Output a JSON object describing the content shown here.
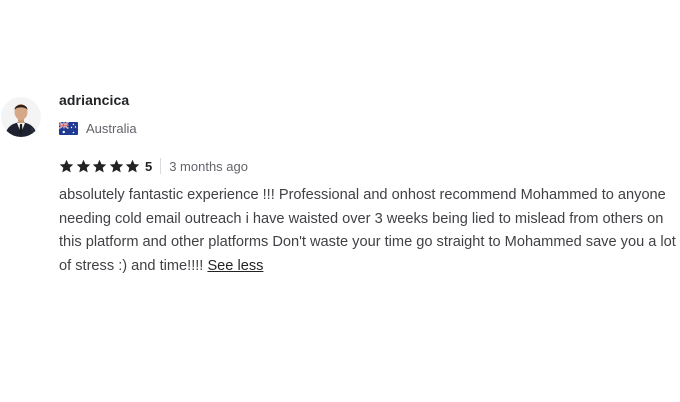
{
  "review": {
    "username": "adriancica",
    "avatar_icon": "user-avatar-photo",
    "country": {
      "flag_icon": "australia-flag-icon",
      "name": "Australia"
    },
    "rating": {
      "stars": 5,
      "max_stars": 5,
      "value": "5",
      "star_color": "#222325"
    },
    "time": "3 months ago",
    "text": "absolutely fantastic experience !!! Professional and onhost recommend Mohammed to anyone needing cold email outreach i have waisted over 3 weeks being lied to mislead from others on this platform and other platforms Don't waste your time go straight to Mohammed save you a lot of stress :) and time!!!!",
    "toggle_label": "See less"
  }
}
